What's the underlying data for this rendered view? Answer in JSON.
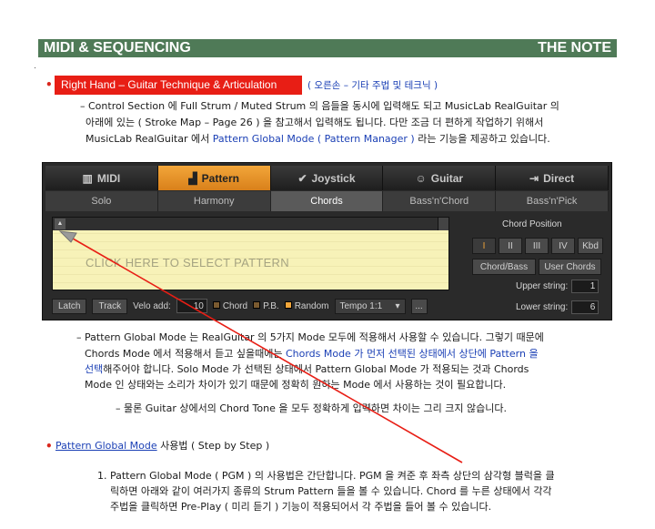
{
  "header": {
    "left": "MIDI & SEQUENCING",
    "right": "THE NOTE"
  },
  "section1": {
    "label": "Right Hand – Guitar Technique & Articulation",
    "label_ko": "( 오른손 – 기타 주법 및 테크닉 )",
    "line1": "– Control Section 에 Full Strum / Muted Strum 의 음들을 동시에 입력해도 되고 MusicLab RealGuitar 의",
    "line2": "아래에 있는 ( Stroke Map – Page 26 ) 을 참고해서 입력해도 됩니다. 다만 조금 더 편하게 작업하기 위해서",
    "line3a": "MusicLab RealGuitar 에서 ",
    "line3_link": "Pattern Global Mode ( Pattern Manager )",
    "line3b": " 라는 기능을 제공하고 있습니다."
  },
  "ui": {
    "tabs_main": [
      {
        "label": "MIDI",
        "icon": "piano-icon"
      },
      {
        "label": "Pattern",
        "icon": "pattern-icon"
      },
      {
        "label": "Joystick",
        "icon": "joystick-icon"
      },
      {
        "label": "Guitar",
        "icon": "guitar-icon"
      },
      {
        "label": "Direct",
        "icon": "direct-icon"
      }
    ],
    "tabs_sub": [
      "Solo",
      "Harmony",
      "Chords",
      "Bass'n'Chord",
      "Bass'n'Pick"
    ],
    "pattern_hint": "CLICK HERE TO SELECT PATTERN",
    "chord_position": {
      "title": "Chord Position",
      "buttons": [
        "I",
        "II",
        "III",
        "IV",
        "Kbd"
      ],
      "mode_buttons": [
        "Chord/Bass",
        "User Chords"
      ],
      "upper_label": "Upper string:",
      "upper_value": "1",
      "lower_label": "Lower string:",
      "lower_value": "6"
    },
    "bottom": {
      "latch": "Latch",
      "track": "Track",
      "velo_label": "Velo add:",
      "velo_value": "10",
      "chord": "Chord",
      "pb": "P.B.",
      "random": "Random",
      "tempo": "Tempo 1:1",
      "more": "..."
    }
  },
  "section2": {
    "line1": "– Pattern Global Mode 는 RealGuitar 의 5가지 Mode 모두에 적용해서 사용할 수 있습니다. 그렇기 때문에",
    "line2a": "Chords Mode 에서 적용해서 듣고 싶을때에는 ",
    "line2_link": "Chords Mode 가 먼저 선택된 상태에서 상단에 Pattern 을",
    "line3_link": "선택",
    "line3b": "해주어야 합니다. Solo Mode 가 선택된 상태에서 Pattern Global Mode 가 적용되는 것과 Chords",
    "line4": "Mode 인 상태와는 소리가 차이가 있기 때문에 정확히 원하는 Mode 에서 사용하는 것이 필요합니다.",
    "line5": "– 물론 Guitar 상에서의 Chord Tone 을 모두 정확하게 입력하면 차이는 그리 크지 않습니다."
  },
  "section3": {
    "label_link": "Pattern Global Mode",
    "label_rest": " 사용법 ( Step by Step )",
    "item1": "1.  Pattern Global Mode ( PGM ) 의 사용법은 간단합니다. PGM 을 켜준 후 좌측 상단의 삼각형 블럭을 클",
    "item1_l2": "릭하면 아래와 같이 여러가지 종류의 Strum Pattern 들을 볼 수 있습니다. Chord 를 누른 상태에서 각각",
    "item1_l3": "주법을 클릭하면 Pre-Play ( 미리 듣기 ) 기능이 적용되어서 각 주법을 들어 볼 수 있습니다."
  },
  "colors": {
    "header_bg": "#4f7a57",
    "red": "#e81e15",
    "link": "#1a3fb5",
    "active_tab": "#f2a63a"
  }
}
